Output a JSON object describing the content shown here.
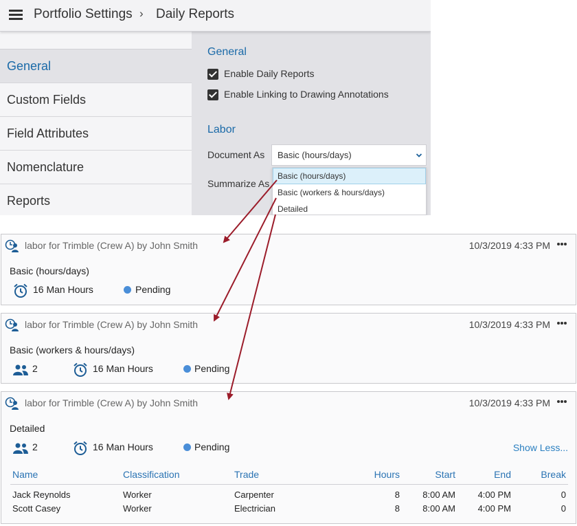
{
  "header": {
    "breadcrumb": [
      "Portfolio Settings",
      "Daily Reports"
    ]
  },
  "sidebar": {
    "items": [
      {
        "label": "General",
        "active": true
      },
      {
        "label": "Custom Fields"
      },
      {
        "label": "Field Attributes"
      },
      {
        "label": "Nomenclature"
      },
      {
        "label": "Reports"
      }
    ]
  },
  "general": {
    "title": "General",
    "enable_daily_reports": "Enable Daily Reports",
    "enable_linking": "Enable Linking to Drawing Annotations"
  },
  "labor": {
    "title": "Labor",
    "document_as_label": "Document As",
    "document_as_value": "Basic (hours/days)",
    "summarize_as_label": "Summarize As",
    "options": [
      "Basic (hours/days)",
      "Basic (workers & hours/days)",
      "Detailed"
    ]
  },
  "cards": [
    {
      "title": "labor for Trimble (Crew A) by John Smith",
      "date": "10/3/2019 4:33 PM",
      "doc_type": "Basic (hours/days)",
      "hours": "16 Man Hours",
      "status": "Pending"
    },
    {
      "title": "labor for Trimble (Crew A) by John Smith",
      "date": "10/3/2019 4:33 PM",
      "doc_type": "Basic (workers & hours/days)",
      "workers": "2",
      "hours": "16 Man Hours",
      "status": "Pending"
    },
    {
      "title": "labor for Trimble (Crew A) by John Smith",
      "date": "10/3/2019 4:33 PM",
      "doc_type": "Detailed",
      "workers": "2",
      "hours": "16 Man Hours",
      "status": "Pending",
      "show_less": "Show Less...",
      "columns": [
        "Name",
        "Classification",
        "Trade",
        "Hours",
        "Start",
        "End",
        "Break"
      ],
      "rows": [
        [
          "Jack Reynolds",
          "Worker",
          "Carpenter",
          "8",
          "8:00 AM",
          "4:00 PM",
          "0"
        ],
        [
          "Scott Casey",
          "Worker",
          "Electrician",
          "8",
          "8:00 AM",
          "4:00 PM",
          "0"
        ]
      ]
    }
  ],
  "colors": {
    "accent": "#1a6aa8",
    "status_dot": "#4a8ed8",
    "arrow": "#9b1c2a"
  },
  "icons": [
    "menu-icon",
    "chevron-down-icon",
    "crew-clock-icon",
    "alarm-clock-icon",
    "people-icon",
    "more-icon"
  ]
}
